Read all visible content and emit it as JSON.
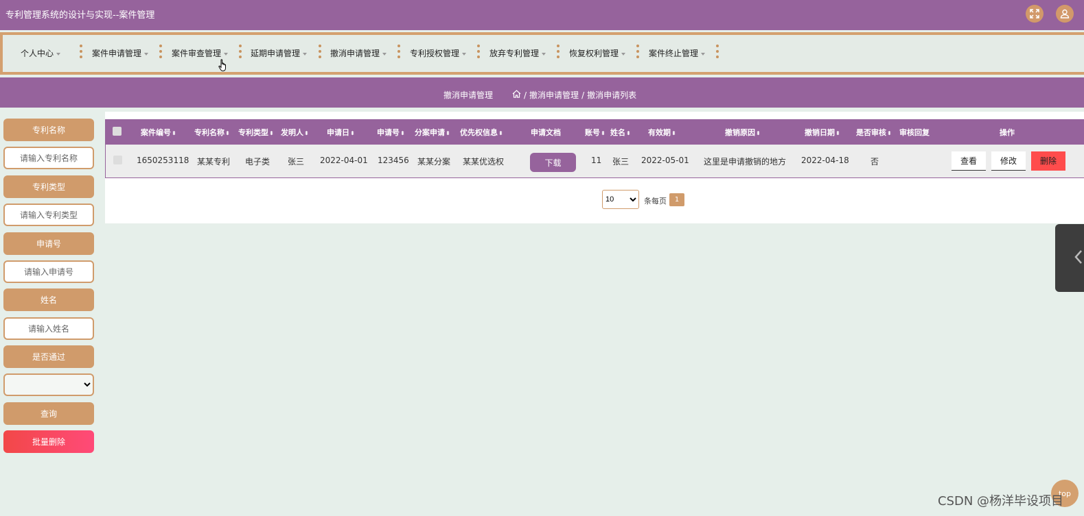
{
  "app": {
    "title": "专利管理系统的设计与实现--案件管理"
  },
  "topbar": {
    "icons": [
      "fullscreen-icon",
      "user-icon"
    ]
  },
  "nav": {
    "items": [
      "个人中心",
      "案件申请管理",
      "案件审查管理",
      "延期申请管理",
      "撤消申请管理",
      "专利授权管理",
      "放弃专利管理",
      "恢复权利管理",
      "案件终止管理"
    ]
  },
  "breadcrumb": {
    "title": "撤消申请管理",
    "path": [
      "撤消申请管理",
      "撤消申请列表"
    ],
    "separator": "/"
  },
  "sidebar": {
    "patent_name_label": "专利名称",
    "patent_name_placeholder": "请输入专利名称",
    "patent_type_label": "专利类型",
    "patent_type_placeholder": "请输入专利类型",
    "app_no_label": "申请号",
    "app_no_placeholder": "请输入申请号",
    "name_label": "姓名",
    "name_placeholder": "请输入姓名",
    "passed_label": "是否通过",
    "passed_value": "",
    "query_label": "查询",
    "batch_delete_label": "批量删除"
  },
  "table": {
    "columns": [
      "案件编号",
      "专利名称",
      "专利类型",
      "发明人",
      "申请日",
      "申请号",
      "分案申请",
      "优先权信息",
      "申请文档",
      "账号",
      "姓名",
      "有效期",
      "撤销原因",
      "撤销日期",
      "是否审核",
      "审核回复",
      "操作"
    ],
    "rows": [
      {
        "case_no": "1650253118",
        "patent_name": "某某专利",
        "patent_type": "电子类",
        "inventor": "张三",
        "apply_date": "2022-04-01",
        "apply_no": "123456",
        "divisional": "某某分案",
        "priority": "某某优选权",
        "doc_button": "下载",
        "account": "11",
        "name": "张三",
        "valid_until": "2022-05-01",
        "revoke_reason": "这里是申请撤销的地方",
        "revoke_date": "2022-04-18",
        "reviewed": "否",
        "review_reply": "",
        "actions": {
          "view": "查看",
          "edit": "修改",
          "delete": "删除"
        }
      }
    ]
  },
  "pagination": {
    "page_size": "10",
    "per_page_label": "条每页",
    "current_page": "1"
  },
  "floating": {
    "top_label": "top"
  },
  "watermark": "CSDN @杨洋毕设项目",
  "colors": {
    "primary": "#96639c",
    "accent": "#d09b6b",
    "danger": "#ff4c4c",
    "background": "#e6efea"
  }
}
